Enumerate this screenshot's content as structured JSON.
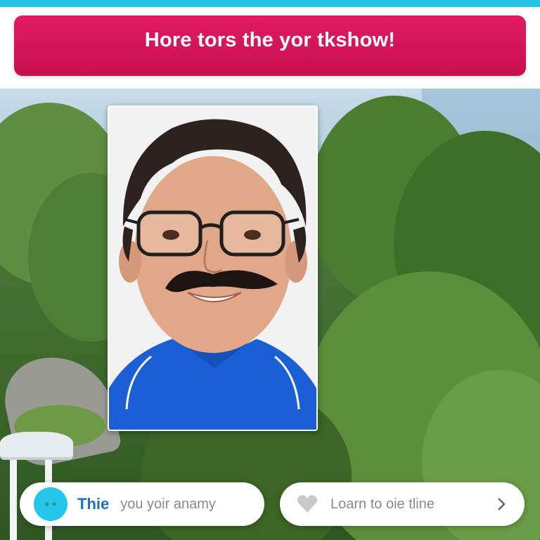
{
  "banner": {
    "title": "Hore tors the yor tkshow!"
  },
  "bottom": {
    "left_pill": {
      "strong_label": "Thie",
      "muted_label": "you yoir anamy"
    },
    "right_pill": {
      "label": "Loarn to oie tline",
      "icon_left": "heart-icon",
      "icon_right": "chevron-right-icon"
    }
  },
  "colors": {
    "top_strip": "#27c4e6",
    "banner": "#d4145a",
    "accent_dot": "#26c6ea",
    "strong_text": "#1e6fc4"
  }
}
